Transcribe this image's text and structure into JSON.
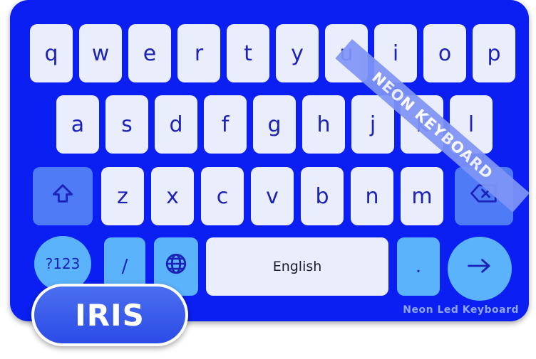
{
  "keyboard": {
    "row1": [
      "q",
      "w",
      "e",
      "r",
      "t",
      "y",
      "u",
      "i",
      "o",
      "p"
    ],
    "row2": [
      "a",
      "s",
      "d",
      "f",
      "g",
      "h",
      "j",
      "k",
      "l"
    ],
    "row3": [
      "z",
      "x",
      "c",
      "v",
      "b",
      "n",
      "m"
    ],
    "symbols_label": "?123",
    "slash_label": "/",
    "space_label": "English",
    "period_label": ".",
    "icons": {
      "shift": "shift-icon",
      "backspace": "backspace-icon",
      "globe": "globe-icon",
      "enter": "arrow-right-icon"
    }
  },
  "ribbon": {
    "label": "NEON KEYBOARD"
  },
  "brand": {
    "label": "Neon Led Keyboard"
  },
  "badge": {
    "label": "IRIS"
  },
  "colors": {
    "board": "#0b1ff2",
    "key": "#eaedfb",
    "key_text": "#1b22b8",
    "function_key": "#4f7cf6",
    "accent_key": "#5bb3fb"
  }
}
